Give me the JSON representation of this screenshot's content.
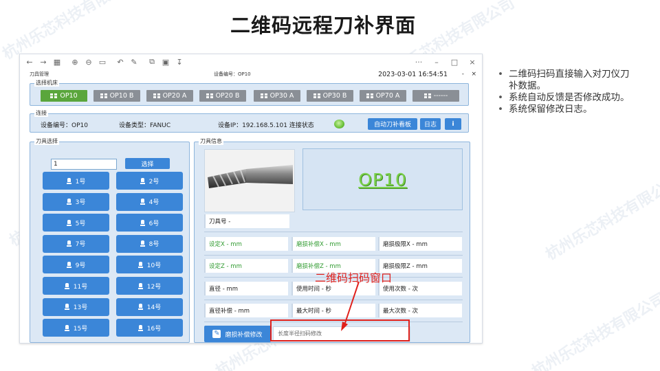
{
  "slide": {
    "title": "二维码远程刀补界面"
  },
  "watermark": "杭州乐芯科技有限公司",
  "toolbar": {
    "more": "···",
    "minimize": "–",
    "maximize": "□",
    "close": "×"
  },
  "window": {
    "title": "刀具管理",
    "device_label": "设备编号：OP10",
    "datetime": "2023-03-01 16:54:51",
    "min": "-",
    "close": "×"
  },
  "machine_select": {
    "legend": "选择机床",
    "buttons": [
      "OP10",
      "OP10 B",
      "OP20 A",
      "OP20 B",
      "OP30 A",
      "OP30 B",
      "OP70 A",
      "------"
    ],
    "active_index": 0
  },
  "connection": {
    "legend": "连接",
    "device_no": "设备编号：OP10",
    "device_type": "设备类型：FANUC",
    "device_ip": "设备IP：192.168.5.101 连接状态",
    "status_color": "#5cb82e",
    "board_btn": "自动刀补看板",
    "log_btn": "日志",
    "info_icon": "i"
  },
  "tool_select": {
    "legend": "刀具选择",
    "input_value": "1",
    "select_btn": "选择",
    "tools": [
      "1号",
      "2号",
      "3号",
      "4号",
      "5号",
      "6号",
      "7号",
      "8号",
      "9号",
      "10号",
      "11号",
      "12号",
      "13号",
      "14号",
      "15号",
      "16号"
    ]
  },
  "tool_info": {
    "legend": "刀具信息",
    "op_name": "OP10",
    "tool_no": "刀具号  -",
    "fields": [
      [
        "设定X  - mm",
        "磨损补偿X  - mm",
        "磨损极限X  - mm"
      ],
      [
        "设定Z  - mm",
        "磨损补偿Z  - mm",
        "磨损极限Z  - mm"
      ],
      [
        "直径  - mm",
        "使用时间  - 秒",
        "使用次数  - 次"
      ],
      [
        "直径补偿  - mm",
        "最大时间  - 秒",
        "最大次数  - 次"
      ]
    ],
    "wear_btn": "磨损补偿修改",
    "scan_placeholder": "长度半径扫码修改"
  },
  "annotation": "二维码扫码窗口",
  "accent_red": "#e0211c",
  "accent_blue": "#3b86d8",
  "bullets": [
    "二维码扫码直接输入对刀仪刀补数据。",
    "系统自动反馈是否修改成功。",
    "系统保留修改日志。"
  ]
}
